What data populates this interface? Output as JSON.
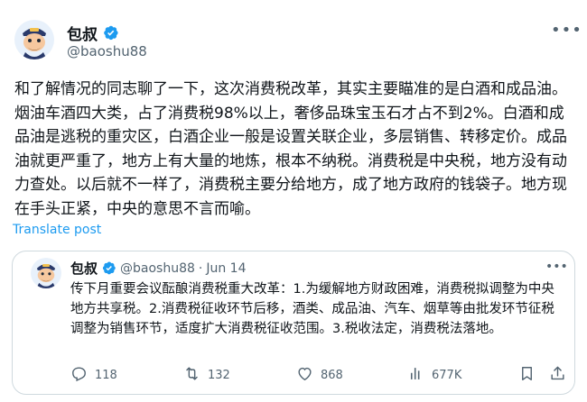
{
  "post": {
    "author_name": "包叔",
    "author_handle": "@baoshu88",
    "more_icon": "more-icon",
    "text": "和了解情况的同志聊了一下，这次消费税改革，其实主要瞄准的是白酒和成品油。烟油车酒四大类，占了消费税98%以上，奢侈品珠宝玉石才占不到2%。白酒和成品油是逃税的重灾区，白酒企业一般是设置关联企业，多层销售、转移定价。成品油就更严重了，地方上有大量的地炼，根本不纳税。消费税是中央税，地方没有动力查处。以后就不一样了，消费税主要分给地方，成了地方政府的钱袋子。地方现在手头正紧，中央的意思不言而喻。",
    "translate_label": "Translate post"
  },
  "quote": {
    "author_name": "包叔",
    "author_handle": "@baoshu88",
    "separator": "·",
    "date": "Jun 14",
    "text": "传下月重要会议酝酿消费税重大改革：1.为缓解地方财政困难，消费税拟调整为中央地方共享税。2.消费税征收环节后移，酒类、成品油、汽车、烟草等由批发环节征税调整为销售环节，适度扩大消费税征收范围。3.税收法定，消费税法落地。"
  },
  "actions": {
    "replies": "118",
    "reposts": "132",
    "likes": "868",
    "views": "677K"
  },
  "colors": {
    "accent": "#1d9bf0",
    "text": "#0f1419",
    "muted": "#536471",
    "border": "#cfd9de"
  }
}
